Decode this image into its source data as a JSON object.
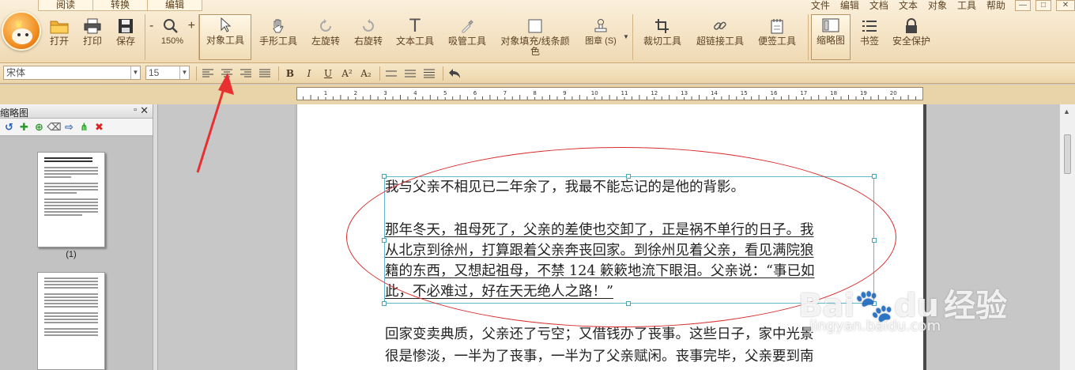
{
  "ribbon": {
    "tabs": [
      "阅读",
      "转换",
      "编辑"
    ],
    "menu": [
      "文件",
      "编辑",
      "文档",
      "文本",
      "对象",
      "工具",
      "帮助"
    ],
    "buttons": {
      "open": "打开",
      "print": "打印",
      "save": "保存",
      "zoom": "150%",
      "object_tool": "对象工具",
      "hand_tool": "手形工具",
      "rotate_left": "左旋转",
      "rotate_right": "右旋转",
      "text_tool": "文本工具",
      "eyedropper": "吸管工具",
      "fill_line_color_1": "对象填充/线条颜",
      "fill_line_color_2": "色",
      "stamp": "图章 (S)",
      "crop_tool": "裁切工具",
      "hyperlink_tool": "超链接工具",
      "sticky_note_tool": "便签工具",
      "thumbnail": "缩略图",
      "bookmark": "书签",
      "security": "安全保护"
    },
    "zoom_minus": "-",
    "zoom_plus": "+"
  },
  "format": {
    "font": "宋体",
    "size": "15",
    "bold": "B",
    "italic": "I",
    "underline": "U",
    "superscript": "A²",
    "subscript": "A₂"
  },
  "ruler": {
    "ticks": [
      "1",
      "2",
      "3",
      "4",
      "5",
      "6",
      "7",
      "8",
      "9",
      "10",
      "11",
      "12",
      "13",
      "14",
      "15",
      "16",
      "17",
      "18",
      "19",
      "20"
    ]
  },
  "panel": {
    "title": "缩略图",
    "pin": "ᵖ",
    "close": "✕",
    "page1_label": "(1)"
  },
  "document": {
    "p1": "我与父亲不相见已二年余了，我最不能忘记的是他的背影。",
    "p2_lines": [
      "那年冬天，祖母死了，父亲的差使也交卸了，正是祸不单行的日子。我",
      "从北京到徐州，打算跟着父亲奔丧回家。到徐州见着父亲，看见满院狼",
      "籍的东西，又想起祖母，不禁 124 簌簌地流下眼泪。父亲说：“事已如",
      "此，不必难过，好在天无绝人之路！”"
    ],
    "p3_lines": [
      "回家变卖典质，父亲还了亏空；又借钱办了丧事。这些日子，家中光景",
      "很是惨淡，一半为了丧事，一半为了父亲赋闲。丧事完毕，父亲要到南"
    ]
  },
  "watermark": {
    "brand": "Bai",
    "brand2": "du",
    "cn": "经验",
    "url": "jingyan.baidu.com"
  },
  "colors": {
    "annotation": "#d92b2b",
    "selection": "#62b8c8",
    "ribbon_bg": "#efd9b3"
  }
}
